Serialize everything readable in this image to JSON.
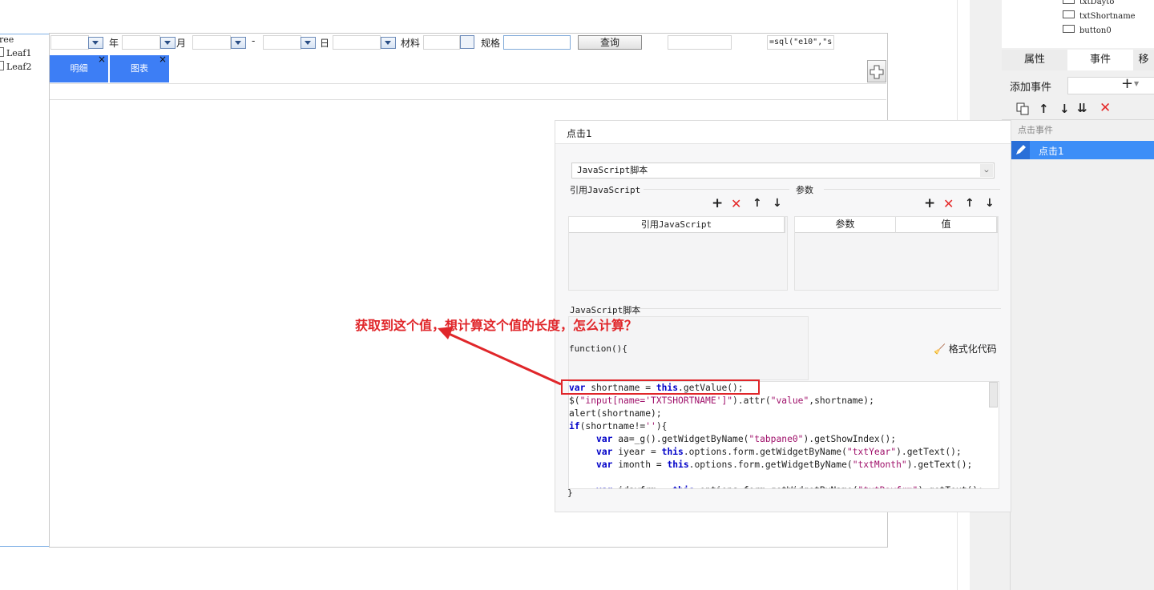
{
  "tree": {
    "root_label": "ree",
    "leaves": [
      "Leaf1",
      "Leaf2"
    ]
  },
  "toolbar": {
    "year_label": "年",
    "month_label": "月",
    "dash_label": "-",
    "day_label": "日",
    "material_label": "材料",
    "spec_label": "规格",
    "query_button": "查询",
    "formula_value": "=sql(\"e10\",\"s"
  },
  "tabs": [
    {
      "label": "明细"
    },
    {
      "label": "图表"
    }
  ],
  "right_panel": {
    "widgets": [
      "txtDayto",
      "txtShortname",
      "button0"
    ],
    "tabs": [
      "属性",
      "事件",
      "移"
    ],
    "add_event_label": "添加事件",
    "section_label": "点击事件",
    "event_item": "点击1"
  },
  "dialog": {
    "title": "点击1",
    "script_type": "JavaScript脚本",
    "ref_js_section": "引用JavaScript",
    "params_section": "参数",
    "ref_js_column": "引用JavaScript",
    "param_column": "参数",
    "value_column": "值",
    "script_section": "JavaScript脚本",
    "function_header": "function(){",
    "format_code": "格式化代码",
    "closing_brace": "}"
  },
  "annotation": {
    "text": "获取到这个值，想计算这个值的长度，怎么计算？",
    "color": "#e0262a"
  },
  "colors": {
    "tab_blue": "#3d7ef5",
    "selected_blue": "#3d8ef7",
    "keyword": "#0000c8",
    "string": "#a0126b",
    "delete_red": "#e52a2a"
  }
}
